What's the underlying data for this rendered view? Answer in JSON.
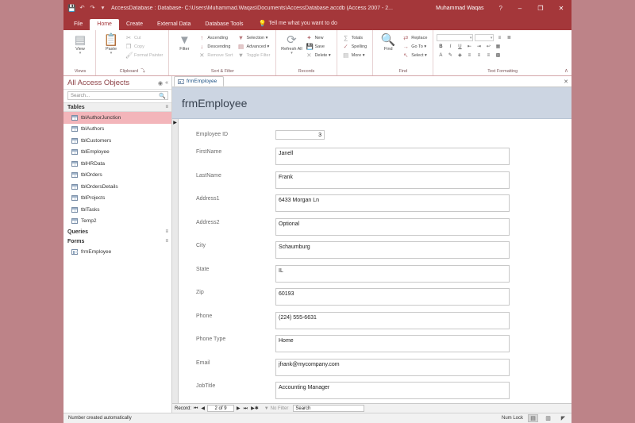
{
  "window": {
    "title": "AccessDatabase : Database- C:\\Users\\Muhammad.Waqas\\Documents\\AccessDatabase.accdb (Access 2007 - 2...",
    "user": "Muhammad Waqas",
    "help_icon": "?",
    "minimize_icon": "–",
    "maximize_icon": "❐",
    "close_icon": "✕",
    "accent_color": "#a4373a",
    "desktop_color": "#bd8388"
  },
  "quick_access": {
    "save": "💾",
    "undo": "↶",
    "redo": "↷",
    "customize": "▾"
  },
  "ribbon": {
    "tabs": [
      {
        "label": "File",
        "active": false
      },
      {
        "label": "Home",
        "active": true
      },
      {
        "label": "Create",
        "active": false
      },
      {
        "label": "External Data",
        "active": false
      },
      {
        "label": "Database Tools",
        "active": false
      }
    ],
    "tellme": "Tell me what you want to do",
    "tellme_icon": "💡",
    "collapse_icon": "∧",
    "groups": [
      {
        "name": "Views",
        "big_button": {
          "label": "View",
          "icon": "▤",
          "caret": "▾"
        }
      },
      {
        "name": "Clipboard",
        "dialog_launcher": "⤵",
        "big_button": {
          "label": "Paste",
          "icon": "📋",
          "caret": "▾"
        },
        "items": [
          {
            "label": "Cut",
            "icon": "✂",
            "dim": true
          },
          {
            "label": "Copy",
            "icon": "❐",
            "dim": true
          },
          {
            "label": "Format Painter",
            "icon": "🖌",
            "dim": true
          }
        ]
      },
      {
        "name": "Sort & Filter",
        "big_button": {
          "label": "Filter",
          "icon": "▼",
          "caret": ""
        },
        "items": [
          {
            "label": "Ascending",
            "icon": "↑",
            "dim": false
          },
          {
            "label": "Descending",
            "icon": "↓",
            "dim": false
          },
          {
            "label": "Remove Sort",
            "icon": "✕",
            "dim": true
          }
        ],
        "items2": [
          {
            "label": "Selection ▾",
            "icon": "▼",
            "dim": false
          },
          {
            "label": "Advanced ▾",
            "icon": "▤",
            "dim": false
          },
          {
            "label": "Toggle Filter",
            "icon": "▼",
            "dim": true
          }
        ]
      },
      {
        "name": "Records",
        "big_button": {
          "label": "Refresh All",
          "icon": "⟳",
          "caret": "▾"
        },
        "items": [
          {
            "label": "New",
            "icon": "✦",
            "dim": false
          },
          {
            "label": "Save",
            "icon": "💾",
            "dim": false
          },
          {
            "label": "Delete ▾",
            "icon": "✕",
            "dim": false
          }
        ],
        "items2": [
          {
            "label": "Totals",
            "icon": "∑",
            "dim": false
          },
          {
            "label": "Spelling",
            "icon": "✓",
            "dim": false
          },
          {
            "label": "More ▾",
            "icon": "▤",
            "dim": false
          }
        ]
      },
      {
        "name": "Find",
        "big_button": {
          "label": "Find",
          "icon": "🔍",
          "caret": ""
        },
        "items": [
          {
            "label": "Replace",
            "icon": "⇄",
            "dim": false
          },
          {
            "label": "Go To ▾",
            "icon": "→",
            "dim": false
          },
          {
            "label": "Select ▾",
            "icon": "↖",
            "dim": false
          }
        ]
      },
      {
        "name": "Text Formatting",
        "dialog_launcher": "⤵",
        "font_name": "",
        "font_size": "",
        "buttons": [
          "B",
          "I",
          "U",
          "▤",
          "▥",
          "¶",
          "≡"
        ],
        "buttons2": [
          "A",
          "✎",
          "↻",
          "≡",
          "≡",
          "≡",
          "░"
        ]
      }
    ]
  },
  "navpane": {
    "title": "All Access Objects",
    "shutter_icon": "◉",
    "collapse_icon": "«",
    "search_placeholder": "Search...",
    "search_icon": "🔍",
    "groups": [
      {
        "label": "Tables",
        "expander": "≡",
        "items": [
          {
            "label": "tblAuthorJunction",
            "selected": true
          },
          {
            "label": "tblAuthors",
            "selected": false
          },
          {
            "label": "tblCustomers",
            "selected": false
          },
          {
            "label": "tblEmployee",
            "selected": false
          },
          {
            "label": "tblHRData",
            "selected": false
          },
          {
            "label": "tblOrders",
            "selected": false
          },
          {
            "label": "tblOrdersDetails",
            "selected": false
          },
          {
            "label": "tblProjects",
            "selected": false
          },
          {
            "label": "tblTasks",
            "selected": false
          },
          {
            "label": "Temp2",
            "selected": false
          }
        ]
      },
      {
        "label": "Queries",
        "expander": "≡",
        "items": []
      },
      {
        "label": "Forms",
        "expander": "≡",
        "items": [
          {
            "label": "frmEmployee",
            "selected": false
          }
        ]
      }
    ]
  },
  "document": {
    "tab_label": "frmEmployee",
    "tab_close": "✕",
    "form_title": "frmEmployee",
    "record_selector_icon": "▶",
    "fields": [
      {
        "label": "Employee ID",
        "value": "3",
        "type": "id"
      },
      {
        "label": "FirstName",
        "value": "Janell",
        "type": "text"
      },
      {
        "label": "LastName",
        "value": "Frank",
        "type": "text"
      },
      {
        "label": "Address1",
        "value": "6433 Morgan Ln",
        "type": "text"
      },
      {
        "label": "Address2",
        "value": "Optional",
        "type": "text"
      },
      {
        "label": "City",
        "value": "Schaumburg",
        "type": "text"
      },
      {
        "label": "State",
        "value": "IL",
        "type": "text"
      },
      {
        "label": "Zip",
        "value": "60193",
        "type": "text"
      },
      {
        "label": "Phone",
        "value": "(224) 555-6631",
        "type": "text"
      },
      {
        "label": "Phone Type",
        "value": "Home",
        "type": "text"
      },
      {
        "label": "Email",
        "value": "jfrank@mycompany.com",
        "type": "text"
      },
      {
        "label": "JobTitle",
        "value": "Accounting Manager",
        "type": "text"
      }
    ]
  },
  "record_nav": {
    "label": "Record:",
    "first_icon": "⏮",
    "prev_icon": "◀",
    "counter": "2 of 9",
    "next_icon": "▶",
    "last_icon": "⏭",
    "new_icon": "▶✱",
    "filter_icon": "▼",
    "filter_label": "No Filter",
    "search_value": "Search"
  },
  "statusbar": {
    "message": "Number created automatically",
    "num_lock": "Num Lock",
    "views": [
      {
        "name": "form-view",
        "icon": "▤",
        "active": true
      },
      {
        "name": "layout-view",
        "icon": "▥",
        "active": false
      },
      {
        "name": "design-view",
        "icon": "◤",
        "active": false
      }
    ]
  }
}
